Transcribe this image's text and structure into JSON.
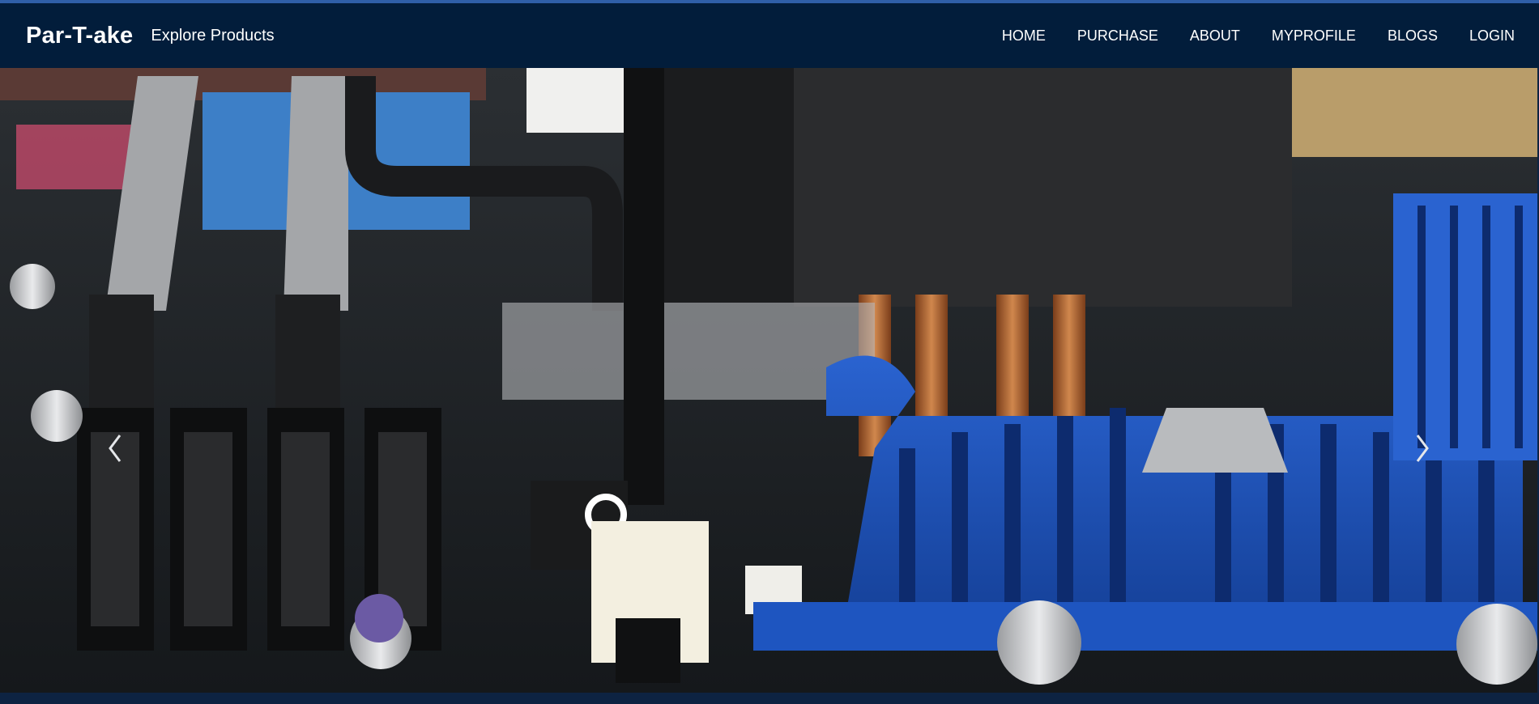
{
  "brand": {
    "name": "Par-T-ake",
    "tagline": "Explore Products"
  },
  "nav": {
    "items": [
      {
        "label": "HOME"
      },
      {
        "label": "PURCHASE"
      },
      {
        "label": "ABOUT"
      },
      {
        "label": "MYPROFILE"
      },
      {
        "label": "BLOGS"
      },
      {
        "label": "LOGIN"
      }
    ]
  },
  "hero": {
    "image": "motherboard-photo",
    "prev_icon": "chevron-left-icon",
    "next_icon": "chevron-right-icon",
    "slides": 3,
    "active_slide": 2
  },
  "colors": {
    "navbar": "#021d3b",
    "accent_rule": "#2f5fa8",
    "heatsink_blue": "#1a4fb3",
    "text": "#ffffff"
  }
}
